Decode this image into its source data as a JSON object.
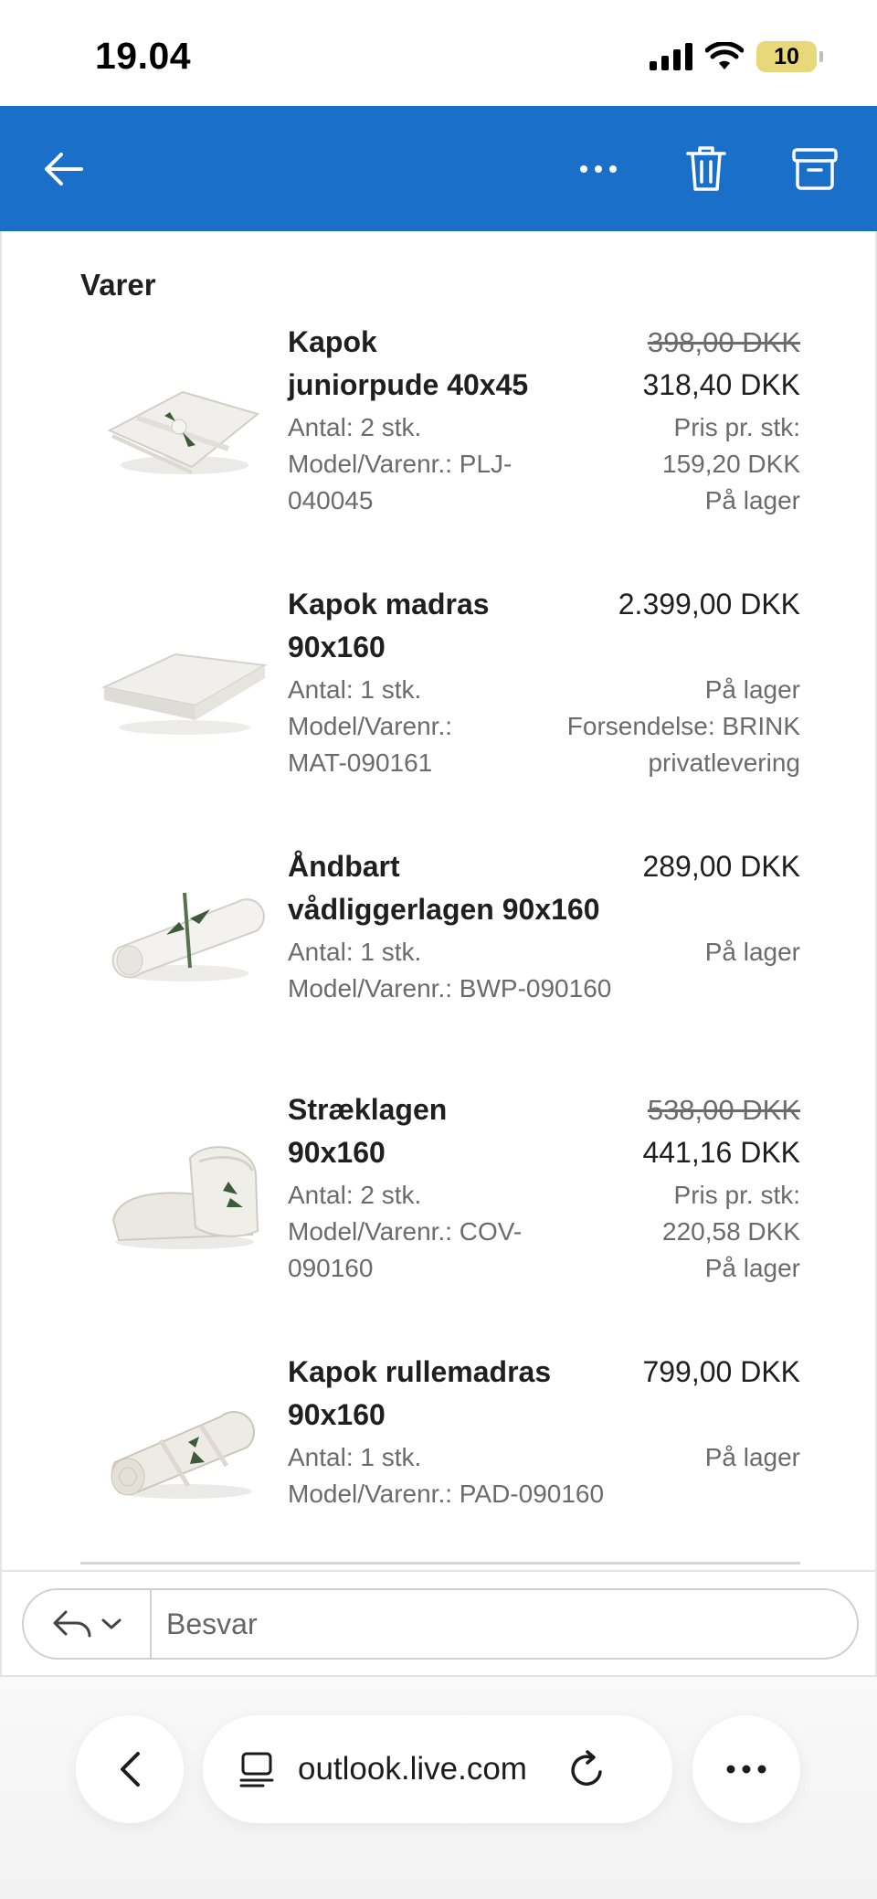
{
  "status_bar": {
    "time": "19.04",
    "battery": "10"
  },
  "header": {
    "back_icon": "arrow-left-icon",
    "more_icon": "more-horizontal-icon",
    "delete_icon": "trash-icon",
    "archive_icon": "archive-icon",
    "color": "#1a6fc9"
  },
  "section_title": "Varer",
  "items": [
    {
      "name_line1": "Kapok",
      "name_line2": "juniorpude 40x45",
      "meta1": "Antal: 2 stk.",
      "meta2": "Model/Varenr.: PLJ-",
      "meta3": "040045",
      "price_old": "398,00 DKK",
      "price": "318,40 DKK",
      "right1": "Pris pr. stk:",
      "right2": "159,20 DKK",
      "right3": "På lager"
    },
    {
      "name_line1": "Kapok madras",
      "name_line2": "90x160",
      "meta1": "Antal: 1 stk.",
      "meta2": "Model/Varenr.:",
      "meta3": "MAT-090161",
      "price": "2.399,00 DKK",
      "right1": "På lager",
      "right2": "Forsendelse: BRINK",
      "right3": "privatlevering"
    },
    {
      "name_line1": "Åndbart",
      "name_line2": "vådliggerlagen 90x160",
      "meta1": "Antal: 1 stk.",
      "meta2": "Model/Varenr.: BWP-090160",
      "price": "289,00 DKK",
      "right1": "På lager"
    },
    {
      "name_line1": "Stræklagen",
      "name_line2": "90x160",
      "meta1": "Antal: 2 stk.",
      "meta2": "Model/Varenr.: COV-",
      "meta3": "090160",
      "price_old": "538,00 DKK",
      "price": "441,16 DKK",
      "right1": "Pris pr. stk:",
      "right2": "220,58 DKK",
      "right3": "På lager"
    },
    {
      "name_line1": "Kapok rullemadras",
      "name_line2": "90x160",
      "meta1": "Antal: 1 stk.",
      "meta2": "Model/Varenr.: PAD-090160",
      "price": "799,00 DKK",
      "right1": "På lager"
    }
  ],
  "reply": {
    "placeholder": "Besvar",
    "reply_icon": "reply-icon",
    "chevron_icon": "chevron-down-icon"
  },
  "browser": {
    "url": "outlook.live.com",
    "back_icon": "chevron-left-icon",
    "page_icon": "page-menu-icon",
    "reload_icon": "reload-icon",
    "more_icon": "more-horizontal-icon"
  }
}
